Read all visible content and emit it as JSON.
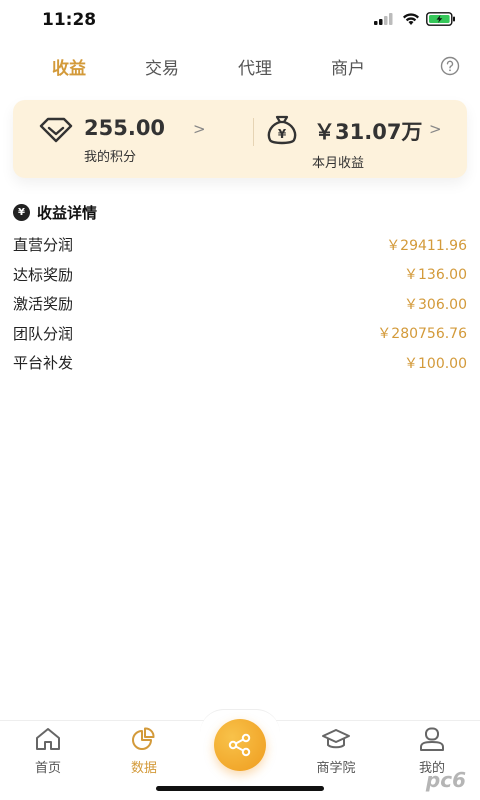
{
  "status_bar": {
    "time": "11:28"
  },
  "tabs": [
    {
      "label": "收益",
      "active": true
    },
    {
      "label": "交易",
      "active": false
    },
    {
      "label": "代理",
      "active": false
    },
    {
      "label": "商户",
      "active": false
    }
  ],
  "summary": {
    "points": {
      "value": "255.00",
      "label": "我的积分"
    },
    "monthly_income": {
      "value": "￥31.07万",
      "label": "本月收益"
    }
  },
  "details": {
    "title": "收益详情",
    "rows": [
      {
        "label": "直营分润",
        "value": "￥29411.96"
      },
      {
        "label": "达标奖励",
        "value": "￥136.00"
      },
      {
        "label": "激活奖励",
        "value": "￥306.00"
      },
      {
        "label": "团队分润",
        "value": "￥280756.76"
      },
      {
        "label": "平台补发",
        "value": "￥100.00"
      }
    ]
  },
  "bottom_nav": {
    "home": "首页",
    "data": "数据",
    "school": "商学院",
    "mine": "我的"
  },
  "watermark": "pc6",
  "colors": {
    "accent": "#d39a3a",
    "card_bg": "#fdf2dc",
    "share_button": "#f5b13a"
  }
}
